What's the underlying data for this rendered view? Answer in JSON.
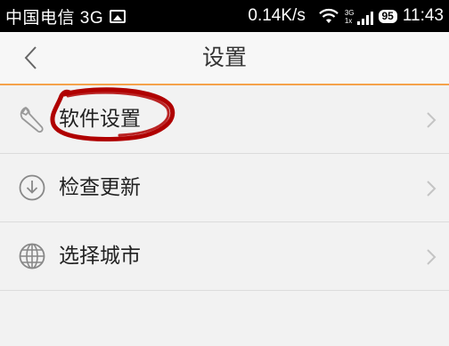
{
  "status_bar": {
    "carrier": "中国电信 3G",
    "speed": "0.14K/s",
    "net_top": "3G",
    "net_bottom": "1x",
    "battery": "95",
    "time": "11:43"
  },
  "header": {
    "title": "设置",
    "back_icon": "chevron-left-icon",
    "accent_color": "#f5a24a"
  },
  "settings_list": {
    "items": [
      {
        "label": "软件设置",
        "icon": "wrench-icon"
      },
      {
        "label": "检查更新",
        "icon": "download-circle-icon"
      },
      {
        "label": "选择城市",
        "icon": "globe-icon"
      }
    ]
  },
  "annotation": {
    "type": "hand-drawn red oval around 软件设置",
    "color": "#b00000"
  }
}
